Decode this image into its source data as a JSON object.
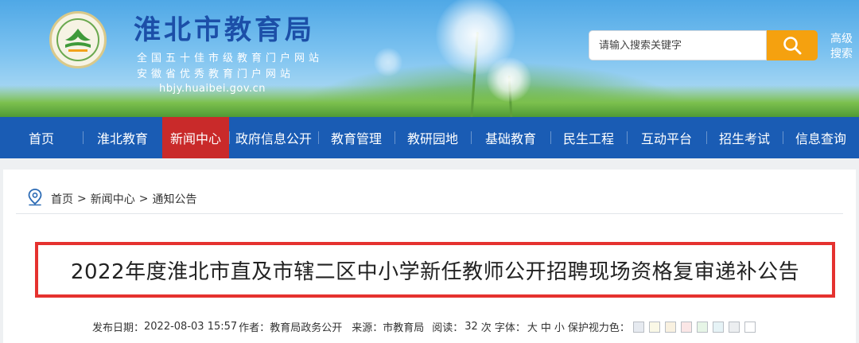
{
  "site": {
    "title": "淮北市教育局",
    "subtitle1": "全国五十佳市级教育门户网站",
    "subtitle2": "安徽省优秀教育门户网站",
    "domain": "hbjy.huaibei.gov.cn",
    "logo_icon": "education-bureau-seal"
  },
  "search": {
    "placeholder": "请输入搜索关键字",
    "button_icon": "search-icon",
    "advanced_label": "高级搜索"
  },
  "nav": {
    "items": [
      "首页",
      "淮北教育",
      "新闻中心",
      "政府信息公开",
      "教育管理",
      "教研园地",
      "基础教育",
      "民生工程",
      "互动平台",
      "招生考试",
      "信息查询"
    ],
    "active_index": 2
  },
  "breadcrumb": {
    "icon": "location-pin-icon",
    "items": [
      "首页",
      "新闻中心",
      "通知公告"
    ],
    "separator": ">"
  },
  "article": {
    "title": "2022年度淮北市直及市辖二区中小学新任教师公开招聘现场资格复审递补公告",
    "meta": {
      "date_label": "发布日期：",
      "date": "2022-08-03 15:57",
      "author_label": "作者：",
      "author": "教育局政务公开",
      "source_label": "来源：",
      "source": "市教育局",
      "reads_label": "阅读：",
      "reads": "32",
      "reads_unit": "次",
      "font_label": "字体：",
      "font_sizes": [
        "大",
        "中",
        "小"
      ],
      "eye_label": "保护视力色："
    }
  },
  "colors": {
    "nav_bg": "#1a5cb4",
    "nav_active": "#c92a2a",
    "search_button": "#f5a10f",
    "title_frame": "#e5322f",
    "eye_swatches": [
      "#e6eaf0",
      "#faf8e6",
      "#f9f1e0",
      "#fbe6e6",
      "#e6f5e6",
      "#e6f3f6",
      "#eceef0",
      "#ffffff"
    ]
  }
}
